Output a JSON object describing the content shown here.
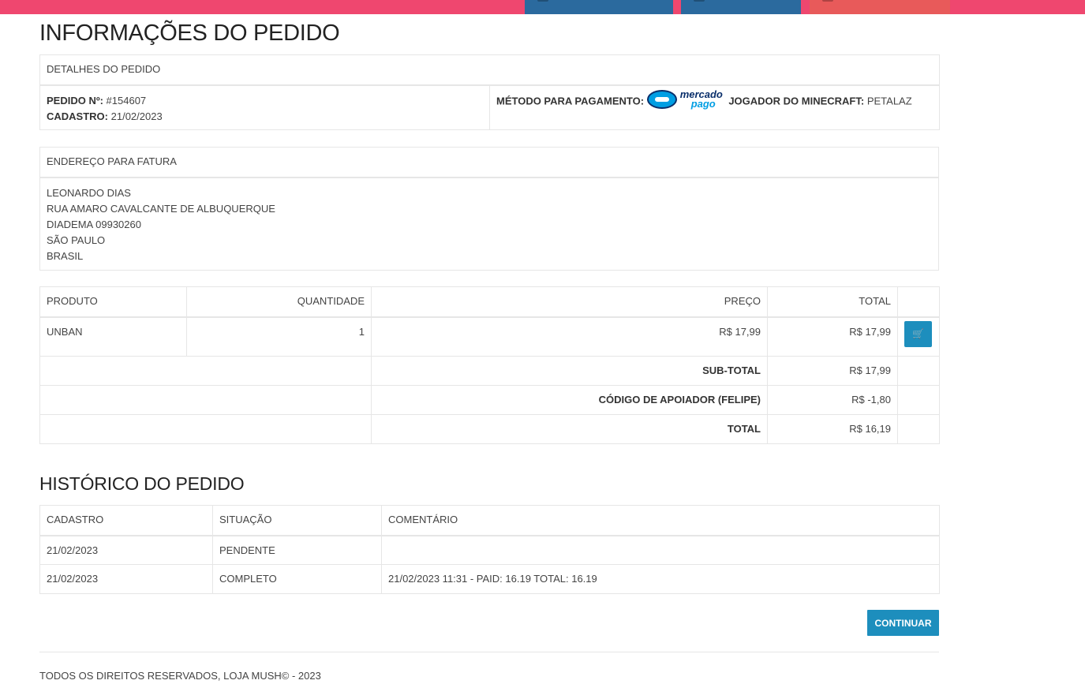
{
  "topbar": {
    "color": "#ef476f",
    "buttons": [
      "",
      "",
      ""
    ]
  },
  "page_title": "INFORMAÇÕES DO PEDIDO",
  "order_details": {
    "header": "DETALHES DO PEDIDO",
    "order_no_label": "PEDIDO Nº:",
    "order_no": "#154607",
    "date_label": "CADASTRO:",
    "date": "21/02/2023",
    "payment_label": "MÉTODO PARA PAGAMENTO:",
    "payment_logo": {
      "line1": "mercado",
      "line2": "pago",
      "icon": "mercado-pago-handshake-icon"
    },
    "player_label": "JOGADOR DO MINECRAFT:",
    "player": "PETALAZ"
  },
  "billing": {
    "header": "ENDEREÇO PARA FATURA",
    "lines": [
      "LEONARDO DIAS",
      "RUA AMARO CAVALCANTE DE ALBUQUERQUE",
      "DIADEMA 09930260",
      "SÃO PAULO",
      "BRASIL"
    ]
  },
  "products": {
    "columns": [
      "PRODUTO",
      "QUANTIDADE",
      "PREÇO",
      "TOTAL"
    ],
    "rows": [
      {
        "name": "UNBAN",
        "qty": "1",
        "price": "R$ 17,99",
        "total": "R$ 17,99",
        "action_icon": "cart-icon"
      }
    ],
    "totals": [
      {
        "label": "SUB-TOTAL",
        "value": "R$ 17,99"
      },
      {
        "label": "CÓDIGO DE APOIADOR (FELIPE)",
        "value": "R$ -1,80"
      },
      {
        "label": "TOTAL",
        "value": "R$ 16,19"
      }
    ]
  },
  "history": {
    "title": "HISTÓRICO DO PEDIDO",
    "columns": [
      "CADASTRO",
      "SITUAÇÃO",
      "COMENTÁRIO"
    ],
    "rows": [
      {
        "date": "21/02/2023",
        "status": "PENDENTE",
        "comment": ""
      },
      {
        "date": "21/02/2023",
        "status": "COMPLETO",
        "comment": "21/02/2023 11:31 - PAID: 16.19 TOTAL: 16.19"
      }
    ]
  },
  "continue_label": "CONTINUAR",
  "footer": "TODOS OS DIREITOS RESERVADOS, LOJA MUSH© - 2023",
  "colors": {
    "accent": "#1d8ebd",
    "topbar": "#ef476f",
    "nav_button": "#2b6a9e",
    "nav_button_alt": "#e85a5a"
  }
}
